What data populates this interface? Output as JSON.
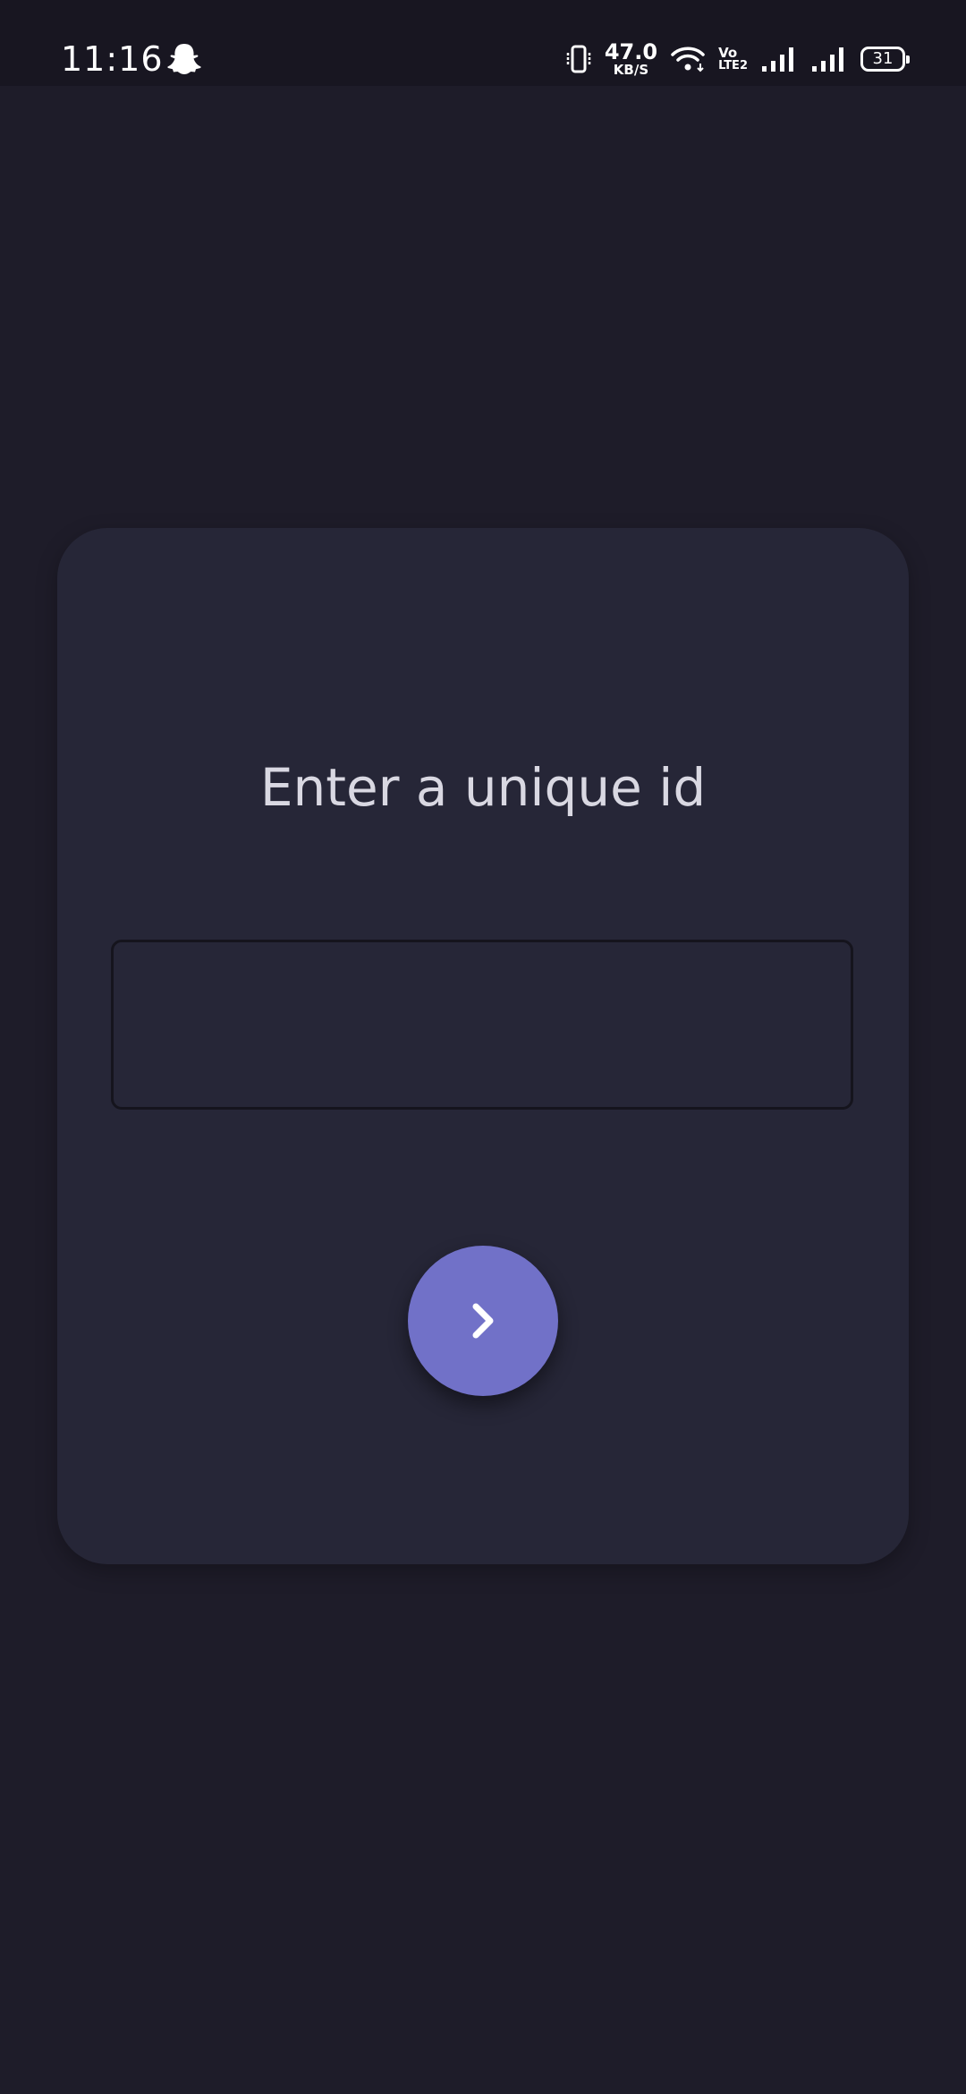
{
  "status_bar": {
    "time": "11:16",
    "net_speed_value": "47.0",
    "net_speed_unit": "KB/S",
    "volte_top": "Vo",
    "volte_bottom": "LTE2",
    "battery_level": "31",
    "icons": [
      "snapchat-ghost-icon",
      "vibrate-icon",
      "wifi-icon",
      "signal-icon",
      "signal-icon",
      "battery-icon"
    ]
  },
  "card": {
    "prompt": "Enter a unique id",
    "input_value": "",
    "next_button_icon": "chevron-right-icon"
  },
  "colors": {
    "background": "#1e1c29",
    "statusbar": "#181621",
    "card": "#262637",
    "accent": "#7171c8",
    "prompt_text": "#d9d8e2"
  }
}
